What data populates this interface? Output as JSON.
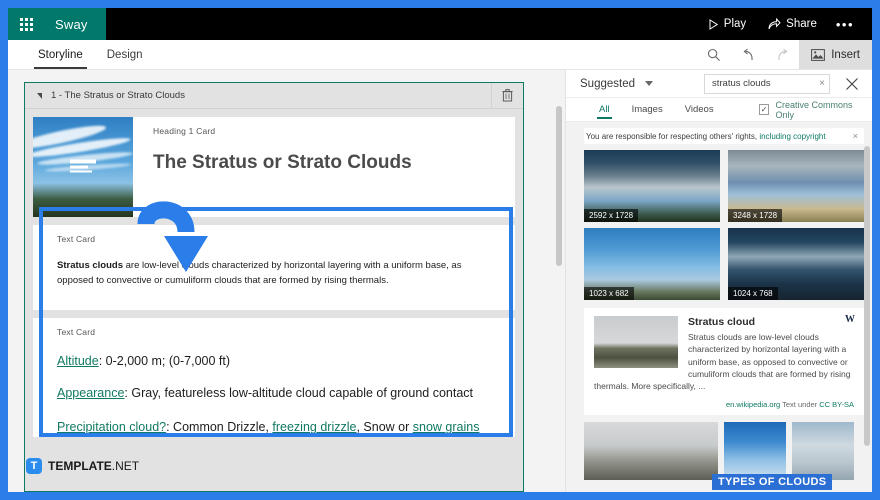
{
  "app": {
    "brand": "Sway",
    "waffle_icon": "app-launcher-waffle-icon"
  },
  "topbar": {
    "play": "Play",
    "share": "Share",
    "more": "•••"
  },
  "ribbon": {
    "tabs": [
      {
        "label": "Storyline",
        "active": true
      },
      {
        "label": "Design",
        "active": false
      }
    ],
    "search_icon": "search-icon",
    "undo_icon": "undo-icon",
    "redo_icon": "redo-icon",
    "insert_label": "Insert",
    "insert_icon": "insert-image-icon"
  },
  "storyline": {
    "section": {
      "title": "1 - The Stratus or Strato Clouds",
      "collapse_icon": "collapse-triangle-icon",
      "delete_icon": "trash-icon"
    },
    "heading_card": {
      "label": "Heading 1 Card",
      "title": "The Stratus or Strato Clouds",
      "thumb_icon": "focus-points-icon"
    },
    "text_card_1": {
      "label": "Text Card",
      "bold_lead": "Stratus clouds",
      "body": " are low-level clouds characterized by horizontal layering with a uniform base, as opposed to convective or cumuliform clouds that are formed by rising thermals."
    },
    "text_card_2": {
      "label": "Text Card",
      "line1_link": "Altitude",
      "line1_text": ": 0-2,000 m; (0-7,000 ft)",
      "line2_link": "Appearance",
      "line2_text": ": Gray, featureless low-altitude cloud capable of ground contact",
      "line3_link": "Precipitation cloud?",
      "line3_text_a": ": Common Drizzle, ",
      "line3_link_b": "freezing drizzle",
      "line3_text_b": ", Snow or ",
      "line3_link_c": "snow grains"
    },
    "annotation_arrow": "blue-curved-arrow"
  },
  "insert_panel": {
    "source": "Suggested",
    "source_chevron": "chevron-down-icon",
    "search_value": "stratus clouds",
    "search_clear": "×",
    "close_icon": "close-icon",
    "tabs": [
      {
        "label": "All",
        "active": true
      },
      {
        "label": "Images",
        "active": false
      },
      {
        "label": "Videos",
        "active": false
      }
    ],
    "creative_commons": {
      "label": "Creative Commons Only",
      "checked": true,
      "check_glyph": "✓"
    },
    "notice": {
      "text": "You are responsible for respecting others' rights, ",
      "link": "including copyright",
      "close": "×"
    },
    "results_row1": [
      {
        "dimensions": "2592 x 1728"
      },
      {
        "dimensions": "3248 x 1728"
      }
    ],
    "results_row2": [
      {
        "dimensions": "1023 x 682"
      },
      {
        "dimensions": "1024 x 768"
      }
    ],
    "wiki_card": {
      "title": "Stratus cloud",
      "description": "Stratus clouds are low-level clouds characterized by horizontal layering with a uniform base, as opposed to convective or cumuliform clouds that are formed by rising",
      "description_tail": "thermals. More specifically, ...",
      "logo": "W",
      "source": "en.wikipedia.org",
      "license_prefix": "Text under ",
      "license": "CC BY-SA"
    },
    "results_row3_banner": "TYPES OF CLOUDS"
  },
  "watermark": {
    "logo": "T",
    "name": "TEMPLATE",
    "suffix": ".NET"
  },
  "colors": {
    "brand_green": "#00796a",
    "accent_blue": "#2b7de9",
    "link_teal": "#117a63",
    "topbar_black": "#000000"
  }
}
